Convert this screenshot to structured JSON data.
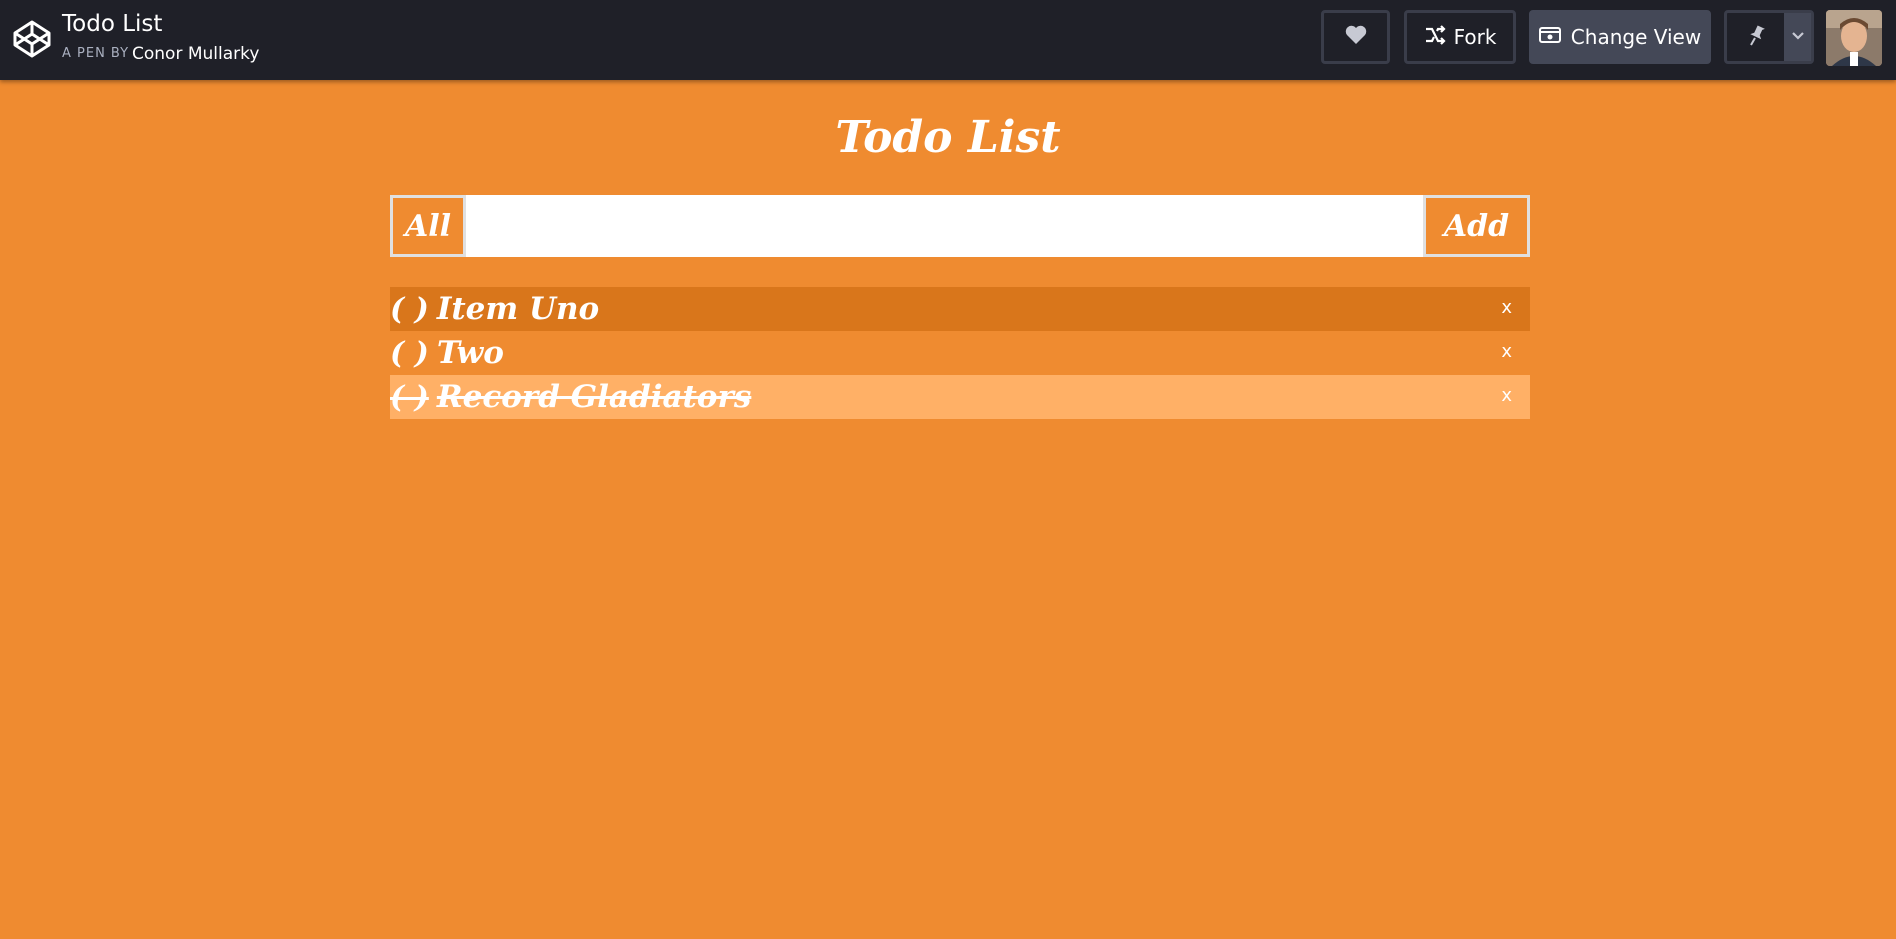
{
  "header": {
    "title": "Todo List",
    "byline": "A PEN BY",
    "author": "Conor Mullarky",
    "buttons": {
      "fork_label": "Fork",
      "change_view_label": "Change View"
    }
  },
  "main": {
    "title": "Todo List",
    "filter_label": "All",
    "input": {
      "value": "",
      "placeholder": ""
    },
    "add_label": "Add",
    "items": [
      {
        "check": "( )",
        "label": "Item Uno",
        "delete": "x",
        "state": "selected"
      },
      {
        "check": "( )",
        "label": "Two",
        "delete": "x",
        "state": "plain"
      },
      {
        "check": "( )",
        "label": "Record Gladiators",
        "delete": "x",
        "state": "done"
      }
    ]
  },
  "colors": {
    "background": "#ef8b30",
    "header_bg": "#1f2028",
    "selected_item": "#d9761b",
    "done_item": "#ffb066"
  }
}
